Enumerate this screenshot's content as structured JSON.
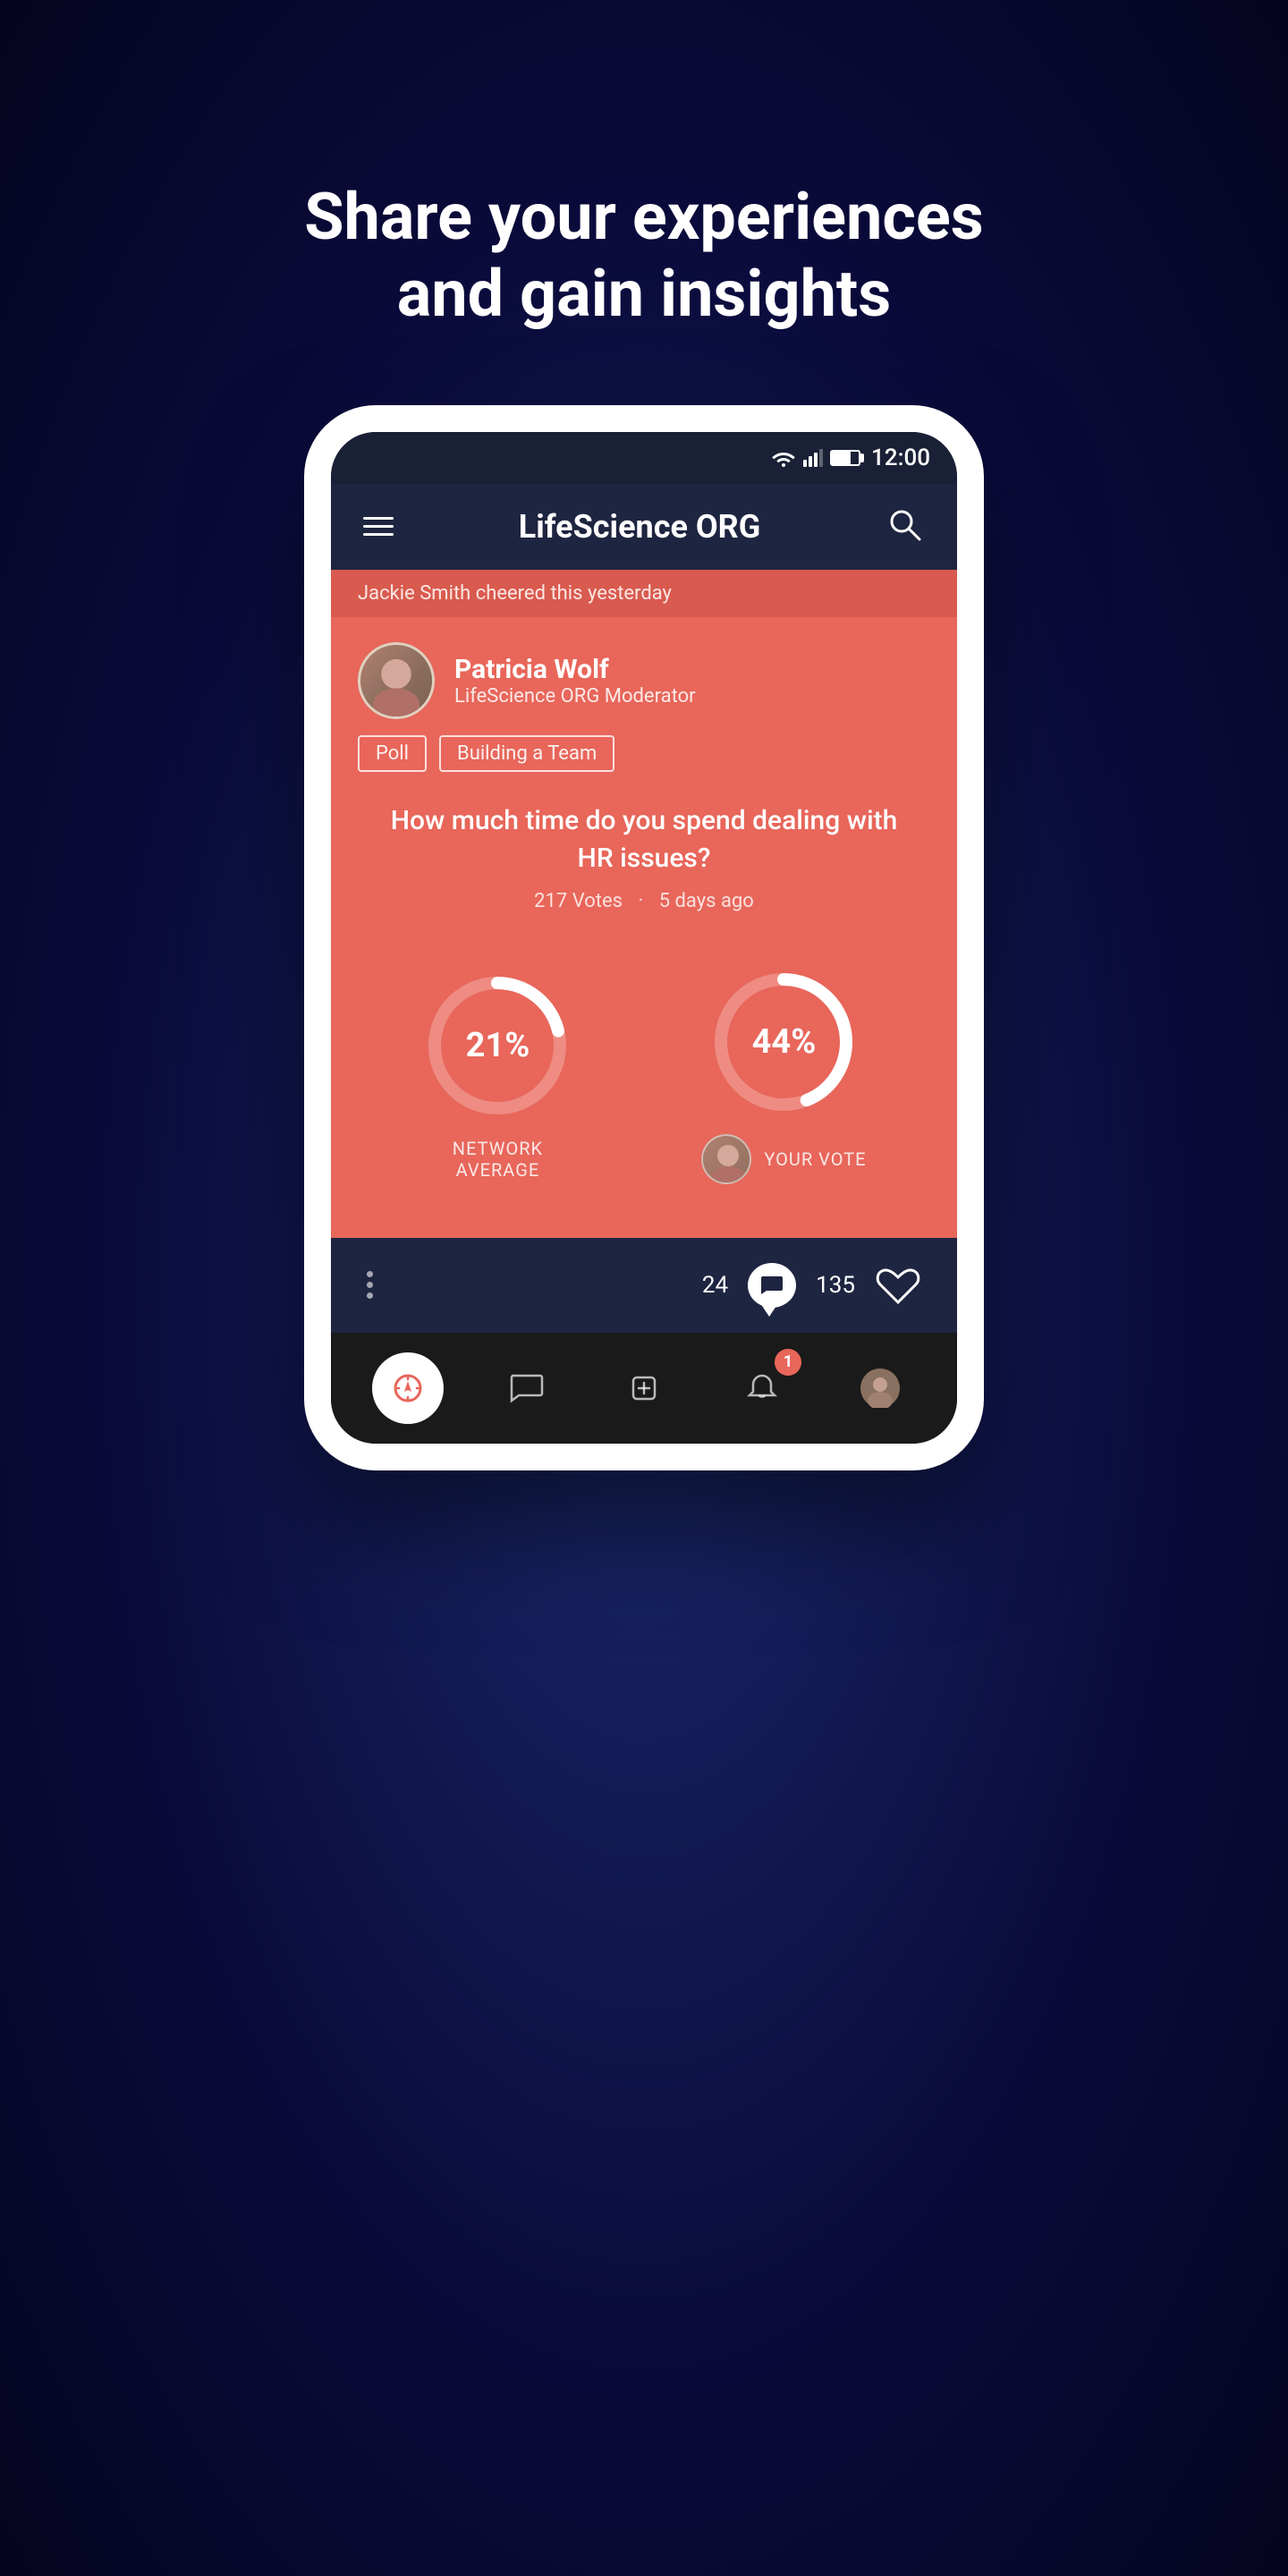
{
  "hero": {
    "line1": "Share your experiences",
    "line2": "and gain insights"
  },
  "statusBar": {
    "time": "12:00"
  },
  "nav": {
    "title": "LifeScience ORG"
  },
  "card": {
    "cheer": "Jackie Smith cheered this yesterday",
    "poster": {
      "name": "Patricia Wolf",
      "role": "LifeScience ORG Moderator"
    },
    "tags": [
      "Poll",
      "Building a Team"
    ],
    "question": "How much time do you spend dealing with HR issues?",
    "votes": "217 Votes",
    "timeAgo": "5 days ago",
    "networkAverage": {
      "value": "21%",
      "label": "NETWORK\nAVERAGE",
      "percent": 21
    },
    "yourVote": {
      "value": "44%",
      "label": "YOUR VOTE",
      "percent": 44
    }
  },
  "actions": {
    "commentCount": "24",
    "likeCount": "135"
  },
  "bottomNav": {
    "items": [
      {
        "name": "compass",
        "active": true
      },
      {
        "name": "chat",
        "active": false
      },
      {
        "name": "add",
        "active": false
      },
      {
        "name": "bell",
        "active": false,
        "badge": "1"
      },
      {
        "name": "profile",
        "active": false
      }
    ]
  }
}
